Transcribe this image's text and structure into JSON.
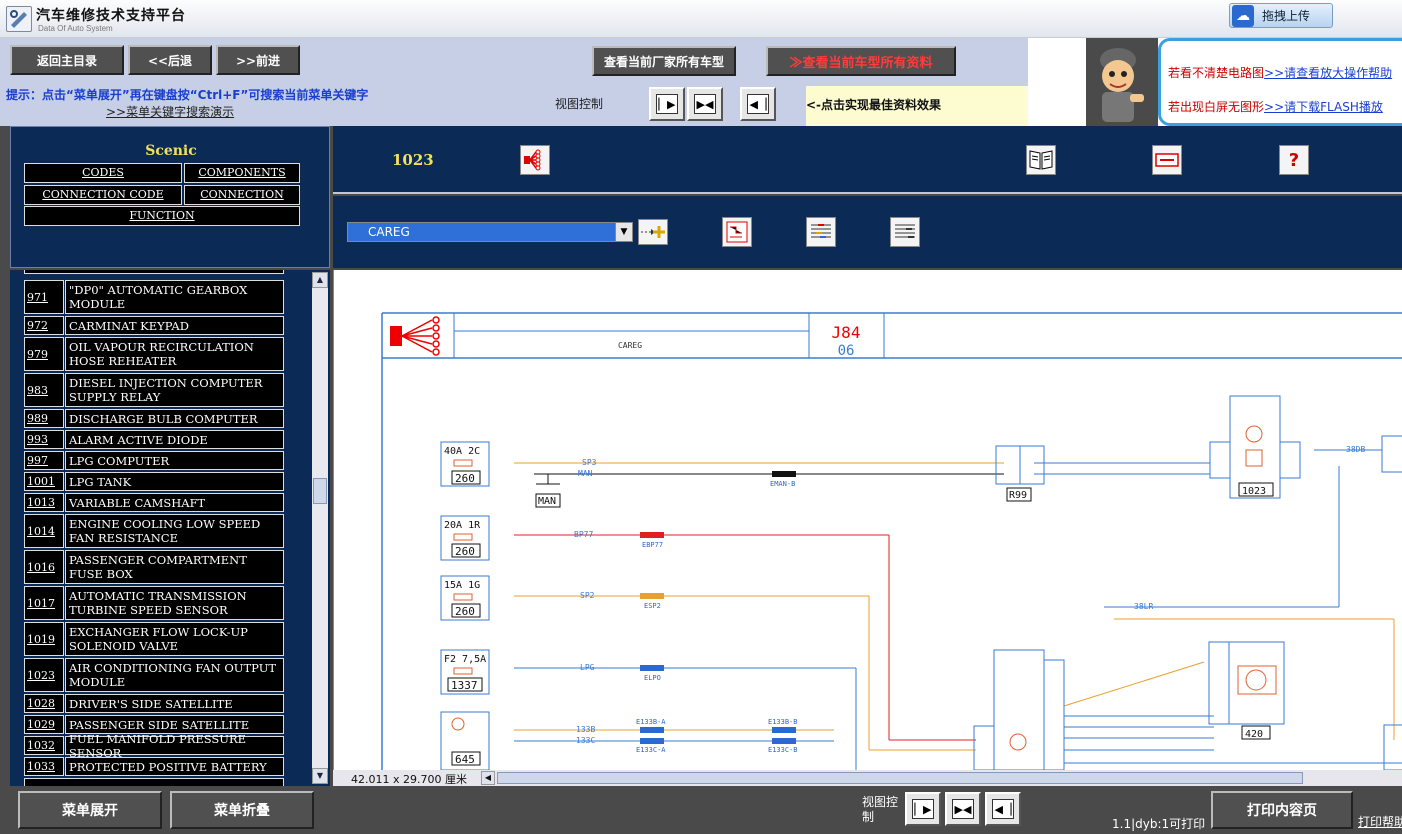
{
  "app": {
    "title": "汽车维修技术支持平台",
    "subtitle": "Data Of Auto System",
    "upload_label": "拖拽上传"
  },
  "nav": {
    "home": "返回主目录",
    "back": "<<后退",
    "forward": ">>前进",
    "all_models": "查看当前厂家所有车型",
    "all_info": "≫查看当前车型所有资料",
    "hint": "提示：点击“菜单展开”再在键盘按“Ctrl+F”可搜索当前菜单关键字",
    "hint_link": ">>菜单关键字搜索演示",
    "view_control": "视图控制",
    "best_effect": "<-点击实现最佳资料效果"
  },
  "promo": {
    "line1_text": "若看不清楚电路图",
    "line1_link": ">>请查看放大操作帮助",
    "line2_text": "若出现白屏无图形",
    "line2_link": ">>请下载FLASH播放"
  },
  "tree": {
    "model": "Scenic",
    "tabs": [
      "CODES",
      "COMPONENTS",
      "CONNECTION CODE",
      "CONNECTION",
      "FUNCTION"
    ],
    "items": [
      {
        "num": "971",
        "name": "\"DP0\" AUTOMATIC GEARBOX MODULE"
      },
      {
        "num": "972",
        "name": "CARMINAT KEYPAD"
      },
      {
        "num": "979",
        "name": "OIL VAPOUR RECIRCULATION HOSE REHEATER"
      },
      {
        "num": "983",
        "name": "DIESEL INJECTION COMPUTER SUPPLY RELAY"
      },
      {
        "num": "989",
        "name": "DISCHARGE BULB COMPUTER"
      },
      {
        "num": "993",
        "name": "ALARM ACTIVE DIODE"
      },
      {
        "num": "997",
        "name": "LPG COMPUTER"
      },
      {
        "num": "1001",
        "name": "LPG TANK"
      },
      {
        "num": "1013",
        "name": "VARIABLE CAMSHAFT"
      },
      {
        "num": "1014",
        "name": "ENGINE COOLING LOW SPEED FAN RESISTANCE"
      },
      {
        "num": "1016",
        "name": "PASSENGER COMPARTMENT FUSE BOX"
      },
      {
        "num": "1017",
        "name": "AUTOMATIC TRANSMISSION TURBINE SPEED SENSOR"
      },
      {
        "num": "1019",
        "name": "EXCHANGER FLOW LOCK-UP SOLENOID VALVE"
      },
      {
        "num": "1023",
        "name": "AIR CONDITIONING FAN OUTPUT MODULE"
      },
      {
        "num": "1028",
        "name": "DRIVER'S SIDE SATELLITE"
      },
      {
        "num": "1029",
        "name": "PASSENGER SIDE SATELLITE"
      },
      {
        "num": "1032",
        "name": "FUEL MANIFOLD PRESSURE SENSOR"
      },
      {
        "num": "1033",
        "name": "PROTECTED POSITIVE BATTERY"
      }
    ]
  },
  "content": {
    "code": "1023",
    "select_value": "CAREG",
    "diagram_title": "CAREG",
    "diagram_code": "J84",
    "diagram_page": "06",
    "dimensions": "42.011 x 29.700 厘米"
  },
  "diagram_labels": {
    "fuses": [
      "40A 2C",
      "20A 1R",
      "15A 1G",
      "F2 7,5A"
    ],
    "fuse_ids": [
      "260",
      "260",
      "260",
      "1337",
      "645"
    ],
    "components": [
      "R99",
      "1023",
      "420",
      "MAN"
    ],
    "wires": [
      "SP3",
      "MAN",
      "BP77",
      "SP2",
      "LPG",
      "133B",
      "133C",
      "38DB",
      "38LR"
    ],
    "connectors": [
      "EMAN-B",
      "EBP77",
      "ESP2",
      "ELPO",
      "E133B-A",
      "E133C-A",
      "E133B-B",
      "E133C-B"
    ]
  },
  "bottom": {
    "expand": "菜单展开",
    "collapse": "菜单折叠",
    "view_control": "视图控制",
    "page_info": "1.1|dyb:1可打印",
    "print": "打印内容页",
    "print_help": "打印帮助"
  }
}
